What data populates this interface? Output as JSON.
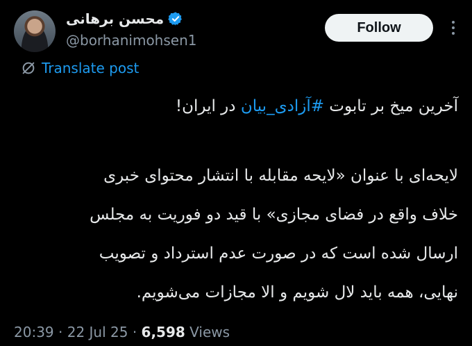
{
  "author": {
    "display_name": "محسن برهانی",
    "handle": "@borhanimohsen1",
    "verified_icon": "verified-badge-icon"
  },
  "follow_label": "Follow",
  "more_icon": "more-options-icon",
  "translate_label": "Translate post",
  "tweet": {
    "line1_before": "آخرین میخ بر تابوت ",
    "hashtag": "#آزادی_بیان",
    "line1_after": " در ایران!",
    "lines": [
      "لایحه‌ای با عنوان «لایحه مقابله با انتشار محتوای خبری",
      "خلاف واقع در فضای مجازی» با قید دو فوریت به مجلس",
      "ارسال شده است که در صورت عدم استرداد و تصویب",
      "نهایی، همه باید لال شویم و الا مجازات می‌شویم."
    ]
  },
  "meta": {
    "time": "20:39",
    "date": "22 Jul 25",
    "views_count": "6,598",
    "views_label": "Views"
  },
  "colors": {
    "background": "#000000",
    "accent": "#1d9bf0",
    "muted": "#8b98a5",
    "text": "#e7e9ea"
  }
}
